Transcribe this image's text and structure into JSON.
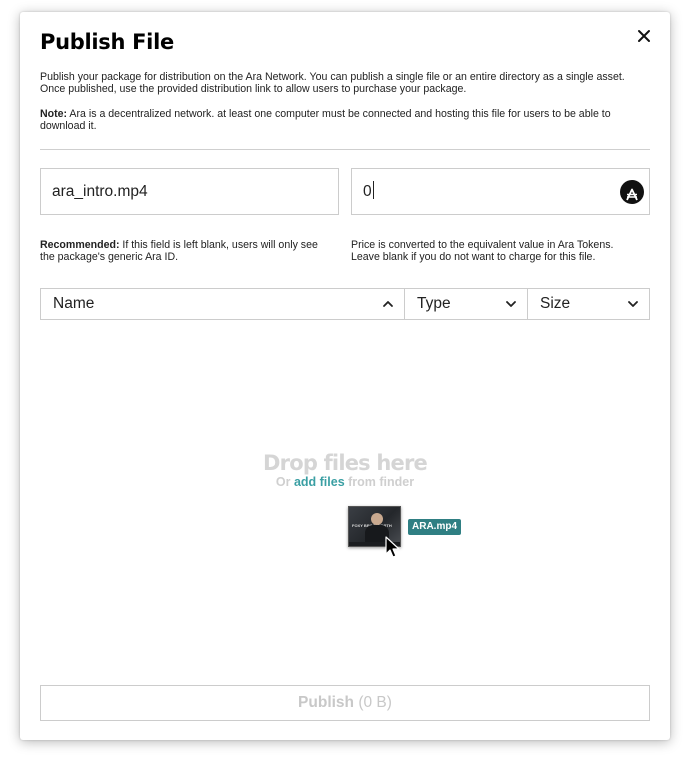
{
  "modal": {
    "title": "Publish File",
    "description": "Publish your package for distribution on the Ara Network. You can publish a single file or an entire directory as a single asset. Once published, use the provided distribution link to allow users to purchase your package.",
    "note_label": "Note:",
    "note_text": " Ara is a decentralized network. at least one computer must be connected and hosting this file for users to be able to download it."
  },
  "form": {
    "name_value": "ara_intro.mp4",
    "price_value": "0",
    "name_hint_label": "Recommended:",
    "name_hint_text": " If this field is left blank, users will only see the package's generic Ara ID.",
    "price_hint": "Price is converted to the equivalent value in Ara Tokens. Leave blank if you do not want to charge for this file."
  },
  "table": {
    "columns": [
      {
        "label": "Name",
        "sort": "chevron-up"
      },
      {
        "label": "Type",
        "sort": "chevron-down"
      },
      {
        "label": "Size",
        "sort": "chevron-down"
      }
    ]
  },
  "dropzone": {
    "title": "Drop files here",
    "prefix": "Or ",
    "link": "add files",
    "suffix": " from finder",
    "dragged_file": "ARA.mp4",
    "thumb_caption": "FOXY BRINKWORTH"
  },
  "publish": {
    "label": "Publish",
    "size": " (0 B)"
  },
  "colors": {
    "accent": "#3a9fa3",
    "badge": "#2f7f83",
    "muted": "#c8c8c8"
  }
}
